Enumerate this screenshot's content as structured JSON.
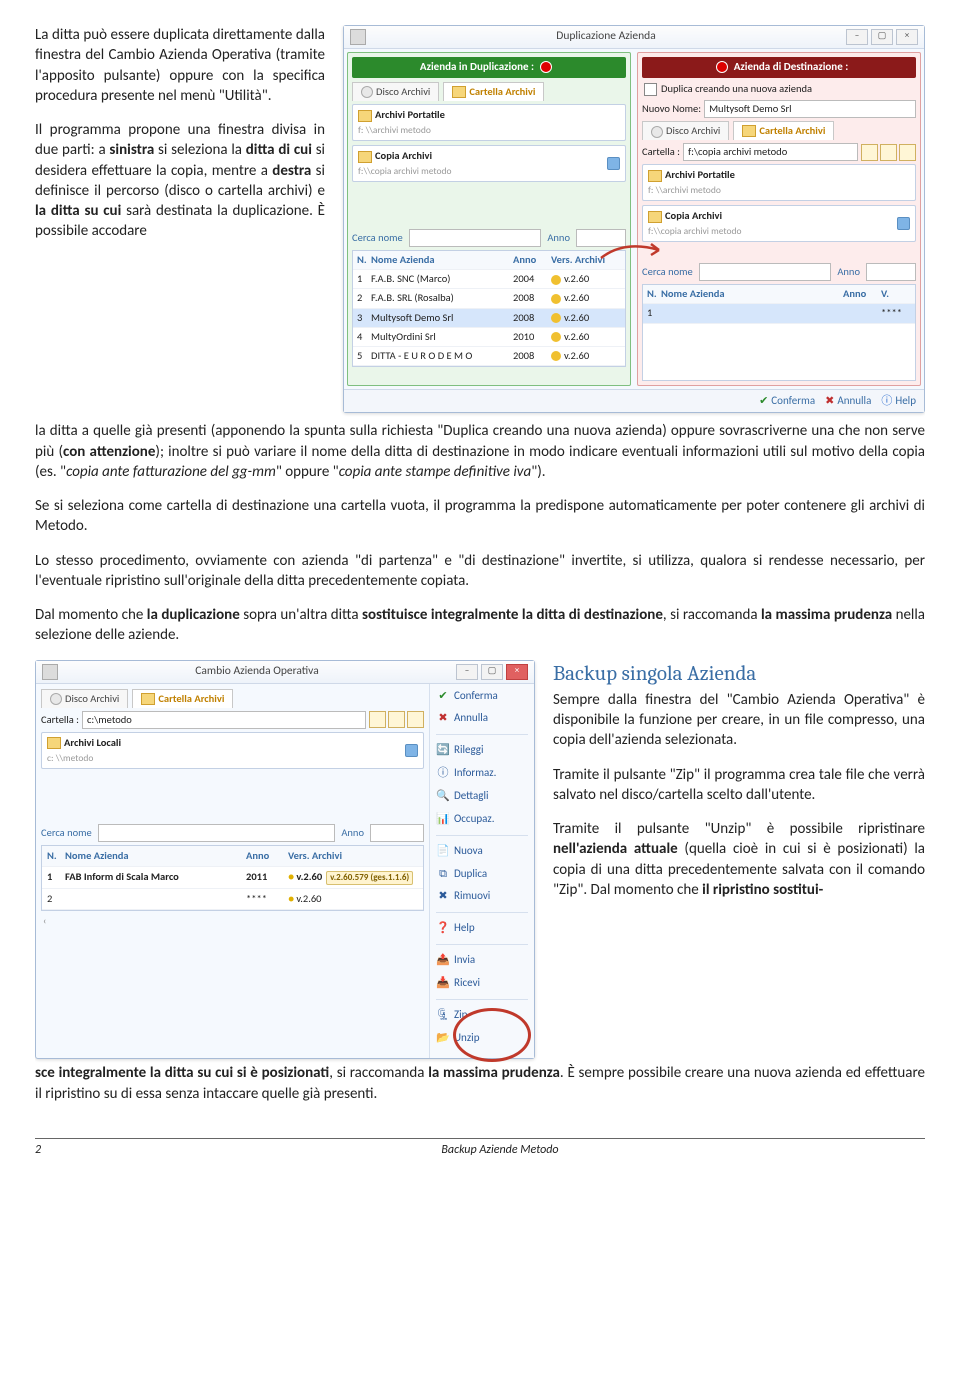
{
  "body_text": {
    "p1": "La ditta può essere duplicata direttamente dalla finestra del Cambio Azienda Operativa (tramite l'apposito pulsante) oppure con la specifica procedura presente nel menù \"Utilità\".",
    "p2a": "Il programma propone una finestra divisa in due parti: a ",
    "p2b": "sinistra",
    "p2c": " si seleziona la ",
    "p2d": "ditta di cui",
    "p2e": " si desidera effettuare la copia, mentre a ",
    "p2f": "destra",
    "p2g": " si definisce il percorso (disco o cartella archivi) e ",
    "p2h": "la ditta su cui",
    "p2i": " sarà destinata la duplicazione. È possibile accodare la ditta a quelle già presenti (apponendo la spunta sulla richiesta \"Duplica creando una nuova azienda) oppure sovrascriverne una che non serve più (",
    "p2j": "con attenzione",
    "p2k": "); inoltre si può variare il nome della ditta di destinazione in modo indicare eventuali informazioni utili sul motivo della copia (es. \"",
    "p2l": "copia ante fatturazione del gg-mm",
    "p2m": "\" oppure \"",
    "p2n": "copia ante stampe definitive iva",
    "p2o": "\").",
    "p3": "Se si seleziona come cartella di destinazione una cartella vuota, il programma la predispone automaticamente per poter contenere gli archivi di Metodo.",
    "p4": "Lo stesso procedimento, ovviamente con azienda \"di partenza\" e \"di destinazione\" invertite, si utilizza, qualora si rendesse necessario, per l'eventuale ripristino sull'originale della ditta precedentemente copiata.",
    "p5a": "Dal momento che ",
    "p5b": "la duplicazione",
    "p5c": " sopra un'altra ditta ",
    "p5d": "sostituisce integralmente la ditta di destinazione",
    "p5e": ", si raccomanda ",
    "p5f": "la massima prudenza",
    "p5g": " nella selezione delle aziende.",
    "h2": "Backup singola Azienda",
    "p6": "Sempre dalla finestra del \"Cambio Azienda Operativa\" è disponibile la funzione per creare, in un file compresso, una copia dell'azienda selezionata.",
    "p7": "Tramite il pulsante \"Zip\" il programma crea tale file che verrà salvato nel disco/cartella scelto dall'utente.",
    "p8a": "Tramite il pulsante \"Unzip\" è possibile ripristinare ",
    "p8b": "nell'azienda attuale",
    "p8c": " (quella cioè in cui si è posizionati) la copia di una ditta precedentemente salvata con il comando \"Zip\". Dal momento che ",
    "p8d": "il ripristino sostituisce integralmente la ditta su cui si è posizionati",
    "p8e": ", si raccomanda ",
    "p8f": "la massima prudenza",
    "p8g": ". È sempre possibile creare una nuova azienda ed effettuare il ripristino su di essa senza intaccare quelle già presenti."
  },
  "dup_win": {
    "title": "Duplicazione Azienda",
    "left_banner": "Azienda in Duplicazione :",
    "right_banner": "Azienda di Destinazione :",
    "tab_disk": "Disco Archivi",
    "tab_folder": "Cartella Archivi",
    "box_archivi": "Archivi Portatile",
    "box_copia": "Copia Archivi",
    "search_name": "Cerca nome",
    "search_year": "Anno",
    "hdr_n": "N.",
    "hdr_name": "Nome Azienda",
    "hdr_anno": "Anno",
    "hdr_ver": "Vers. Archivi",
    "rows": [
      {
        "n": "1",
        "name": "F.A.B. SNC (Marco)",
        "anno": "2004",
        "ver": "v.2.60"
      },
      {
        "n": "2",
        "name": "F.A.B. SRL (Rosalba)",
        "anno": "2008",
        "ver": "v.2.60"
      },
      {
        "n": "3",
        "name": "Multysoft Demo Srl",
        "anno": "2008",
        "ver": "v.2.60"
      },
      {
        "n": "4",
        "name": "MultyOrdini Srl",
        "anno": "2010",
        "ver": "v.2.60"
      },
      {
        "n": "5",
        "name": "DITTA  - E U R O   D E M O",
        "anno": "2008",
        "ver": "v.2.60"
      }
    ],
    "chk_label": "Duplica creando una nuova azienda",
    "nuovo_nome_lbl": "Nuovo Nome:",
    "nuovo_nome_val": "Multysoft Demo Srl",
    "cartella_lbl": "Cartella :",
    "cartella_val": "f:\\copia archivi metodo",
    "right_hdr_v": "V.",
    "right_row_ver": "****",
    "btn_conferma": "Conferma",
    "btn_annulla": "Annulla",
    "btn_help": "Help"
  },
  "cam_win": {
    "title": "Cambio Azienda Operativa",
    "tab_disk": "Disco Archivi",
    "tab_folder": "Cartella Archivi",
    "cartella_lbl": "Cartella :",
    "cartella_val": "c:\\metodo",
    "box_locali": "Archivi Locali",
    "search_name": "Cerca nome",
    "search_year": "Anno",
    "hdr_n": "N.",
    "hdr_name": "Nome Azienda",
    "hdr_anno": "Anno",
    "hdr_ver": "Vers. Archivi",
    "rows": [
      {
        "n": "1",
        "name": "FAB Inform di Scala Marco",
        "anno": "2011",
        "ver": "v.2.60",
        "badge": "v.2.60.579  (ges.1.1.6)"
      },
      {
        "n": "2",
        "name": "",
        "anno": "****",
        "ver": "v.2.60",
        "badge": ""
      }
    ],
    "btns": {
      "conferma": "Conferma",
      "annulla": "Annulla",
      "rileggi": "Rileggi",
      "informaz": "Informaz.",
      "dettagli": "Dettagli",
      "occupaz": "Occupaz.",
      "nuova": "Nuova",
      "duplica": "Duplica",
      "rimuovi": "Rimuovi",
      "help": "Help",
      "invia": "Invia",
      "ricevi": "Ricevi",
      "zip": "Zip",
      "unzip": "Unzip"
    }
  },
  "footer": {
    "page": "2",
    "title": "Backup Aziende Metodo"
  }
}
